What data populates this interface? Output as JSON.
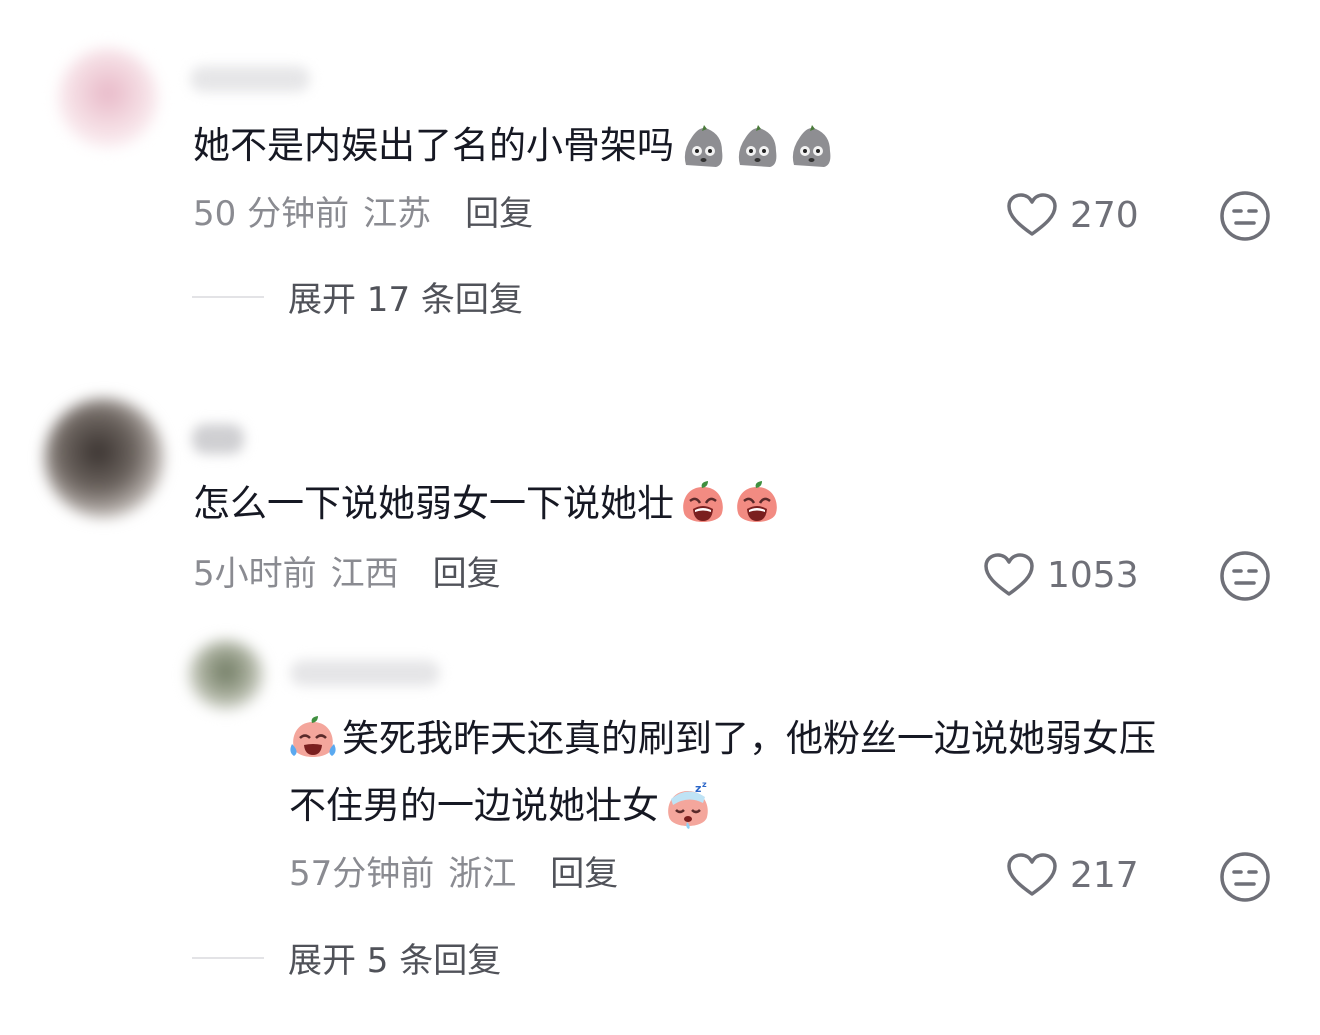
{
  "comments": [
    {
      "text": "她不是内娱出了名的小骨架吗",
      "emojis": [
        "stone-face-emoji",
        "stone-face-emoji",
        "stone-face-emoji"
      ],
      "time": "50 分钟前",
      "location": "江苏",
      "reply_label": "回复",
      "likes": "270",
      "expand_label": "展开 17 条回复"
    },
    {
      "text": "怎么一下说她弱女一下说她壮",
      "emojis": [
        "crying-peach-emoji",
        "crying-peach-emoji"
      ],
      "time": "5小时前",
      "location": "江西",
      "reply_label": "回复",
      "likes": "1053"
    }
  ],
  "reply": {
    "text_line1": "笑死我昨天还真的刷到了，他粉丝一边说她弱女压",
    "text_line2": "不住男的一边说她壮女",
    "lead_emoji": "laughing-crying-peach-emoji",
    "trail_emoji": "sleepy-peach-emoji",
    "time": "57分钟前",
    "location": "浙江",
    "reply_label": "回复",
    "likes": "217",
    "expand_label": "展开 5 条回复"
  },
  "colors": {
    "text": "#161823",
    "meta": "#8a8b91",
    "icon": "#6f7078",
    "divider": "#e3e3e6"
  }
}
